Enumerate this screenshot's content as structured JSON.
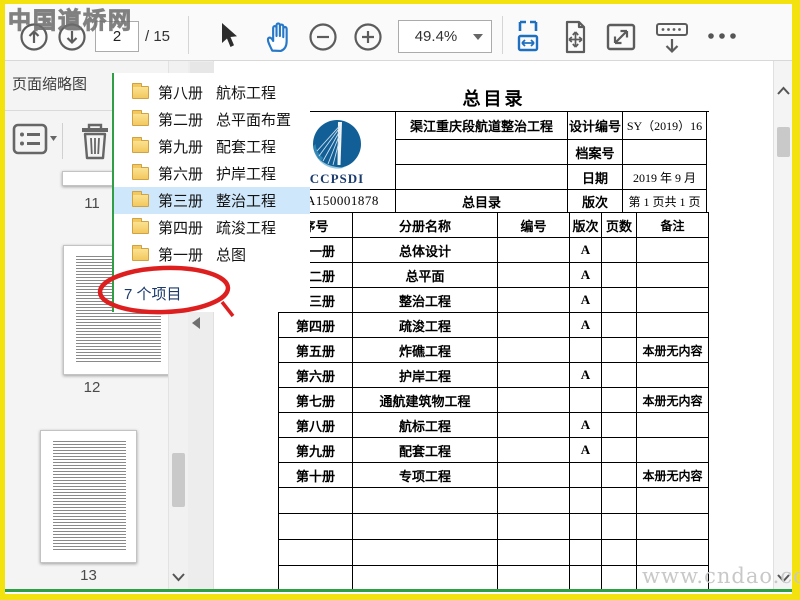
{
  "colors": {
    "accent_blue": "#2878c8",
    "fit_blue": "#1f6fc0",
    "selection": "#cfe7fb",
    "folder_yellow": "#f3c85f",
    "annotation_red": "#de1f1f",
    "popup_border_green": "#2f9e44",
    "frame_yellow": "#f4e20e"
  },
  "watermarks": {
    "top_left": "中国道桥网",
    "bottom_right": "www.cndao.com"
  },
  "toolbar": {
    "page_current": "2",
    "page_total": "/ 15",
    "zoom": "49.4%"
  },
  "sidebar": {
    "title": "页面缩略图",
    "thumbnails": [
      {
        "label": "11"
      },
      {
        "label": "12"
      },
      {
        "label": "13"
      }
    ]
  },
  "popup": {
    "status": "7 个项目",
    "items": [
      {
        "volume": "第八册",
        "name": "航标工程",
        "selected": false
      },
      {
        "volume": "第二册",
        "name": "总平面布置",
        "selected": false
      },
      {
        "volume": "第九册",
        "name": "配套工程",
        "selected": false
      },
      {
        "volume": "第六册",
        "name": "护岸工程",
        "selected": false
      },
      {
        "volume": "第三册",
        "name": "整治工程",
        "selected": true
      },
      {
        "volume": "第四册",
        "name": "疏浚工程",
        "selected": false
      },
      {
        "volume": "第一册",
        "name": "总图",
        "selected": false
      }
    ]
  },
  "document": {
    "title": "总目录",
    "header": {
      "logo": "CCPSDI",
      "project": "渠江重庆段航道整治工程",
      "doc_name": "总目录",
      "code": "A150001878",
      "fields": [
        {
          "label": "设计编号",
          "value": "SY（2019）16"
        },
        {
          "label": "档案号",
          "value": ""
        },
        {
          "label": "日期",
          "value": "2019 年 9 月"
        },
        {
          "label": "版次",
          "value": "第 1 页共 1 页"
        }
      ]
    },
    "table": {
      "columns": [
        "序号",
        "分册名称",
        "编号",
        "版次",
        "页数",
        "备注"
      ],
      "rows": [
        [
          "第一册",
          "总体设计",
          "",
          "A",
          "",
          ""
        ],
        [
          "第二册",
          "总平面",
          "",
          "A",
          "",
          ""
        ],
        [
          "第三册",
          "整治工程",
          "",
          "A",
          "",
          ""
        ],
        [
          "第四册",
          "疏浚工程",
          "",
          "A",
          "",
          ""
        ],
        [
          "第五册",
          "炸礁工程",
          "",
          "",
          "",
          "本册无内容"
        ],
        [
          "第六册",
          "护岸工程",
          "",
          "A",
          "",
          ""
        ],
        [
          "第七册",
          "通航建筑物工程",
          "",
          "",
          "",
          "本册无内容"
        ],
        [
          "第八册",
          "航标工程",
          "",
          "A",
          "",
          ""
        ],
        [
          "第九册",
          "配套工程",
          "",
          "A",
          "",
          ""
        ],
        [
          "第十册",
          "专项工程",
          "",
          "",
          "",
          "本册无内容"
        ],
        [
          "",
          "",
          "",
          "",
          "",
          ""
        ],
        [
          "",
          "",
          "",
          "",
          "",
          ""
        ],
        [
          "",
          "",
          "",
          "",
          "",
          ""
        ],
        [
          "",
          "",
          "",
          "",
          "",
          ""
        ]
      ]
    }
  }
}
